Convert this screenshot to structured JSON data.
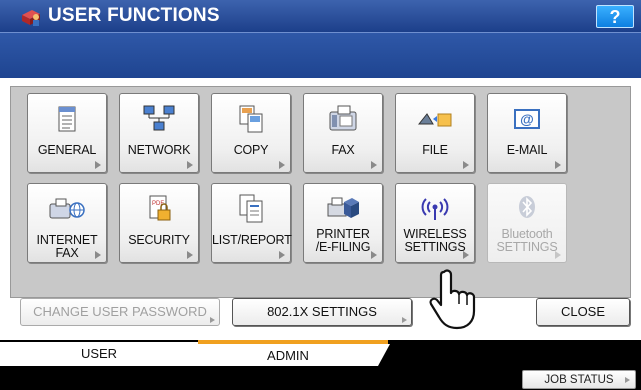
{
  "header": {
    "title": "USER FUNCTIONS",
    "help_label": "?"
  },
  "functions": [
    {
      "label": "GENERAL",
      "icon": "document-icon",
      "enabled": true
    },
    {
      "label": "NETWORK",
      "icon": "network-icon",
      "enabled": true
    },
    {
      "label": "COPY",
      "icon": "copy-icon",
      "enabled": true
    },
    {
      "label": "FAX",
      "icon": "fax-icon",
      "enabled": true
    },
    {
      "label": "FILE",
      "icon": "file-folder-icon",
      "enabled": true
    },
    {
      "label": "E-MAIL",
      "icon": "email-icon",
      "enabled": true
    },
    {
      "label": "INTERNET FAX",
      "icon": "internet-fax-icon",
      "enabled": true
    },
    {
      "label": "SECURITY",
      "icon": "pdf-lock-icon",
      "enabled": true
    },
    {
      "label": "LIST/REPORT",
      "icon": "list-report-icon",
      "enabled": true
    },
    {
      "label_line1": "PRINTER",
      "label_line2": "/E-FILING",
      "icon": "printer-box-icon",
      "enabled": true
    },
    {
      "label_line1": "WIRELESS",
      "label_line2": "SETTINGS",
      "icon": "wireless-icon",
      "enabled": true
    },
    {
      "label_line1": "Bluetooth",
      "label_line2": "SETTINGS",
      "icon": "bluetooth-icon",
      "enabled": false
    }
  ],
  "actions": {
    "change_password": "CHANGE USER PASSWORD",
    "settings_8021x": "802.1X SETTINGS",
    "close": "CLOSE"
  },
  "tabs": {
    "user": "USER",
    "admin": "ADMIN",
    "active": "ADMIN"
  },
  "status": {
    "job_status": "JOB STATUS"
  },
  "colors": {
    "title_bar": "#1c3f8a",
    "help_button": "#0d7fe0",
    "active_tab_accent": "#f0a020"
  }
}
